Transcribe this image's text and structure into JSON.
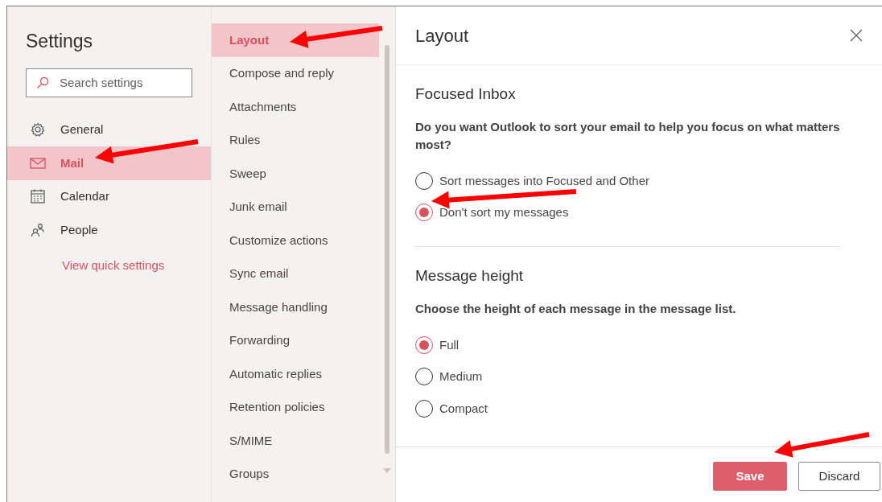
{
  "settings": {
    "title": "Settings",
    "search": {
      "placeholder": "Search settings"
    },
    "categories": [
      {
        "label": "General",
        "kind": "general",
        "selected": false
      },
      {
        "label": "Mail",
        "kind": "mail",
        "selected": true
      },
      {
        "label": "Calendar",
        "kind": "calendar",
        "selected": false
      },
      {
        "label": "People",
        "kind": "people",
        "selected": false
      }
    ],
    "quick_link": "View quick settings"
  },
  "subcategories": [
    {
      "label": "Layout",
      "selected": true
    },
    {
      "label": "Compose and reply",
      "selected": false
    },
    {
      "label": "Attachments",
      "selected": false
    },
    {
      "label": "Rules",
      "selected": false
    },
    {
      "label": "Sweep",
      "selected": false
    },
    {
      "label": "Junk email",
      "selected": false
    },
    {
      "label": "Customize actions",
      "selected": false
    },
    {
      "label": "Sync email",
      "selected": false
    },
    {
      "label": "Message handling",
      "selected": false
    },
    {
      "label": "Forwarding",
      "selected": false
    },
    {
      "label": "Automatic replies",
      "selected": false
    },
    {
      "label": "Retention policies",
      "selected": false
    },
    {
      "label": "S/MIME",
      "selected": false
    },
    {
      "label": "Groups",
      "selected": false
    }
  ],
  "panel": {
    "title": "Layout",
    "sections": [
      {
        "heading": "Focused Inbox",
        "question": "Do you want Outlook to sort your email to help you focus on what matters most?",
        "options": [
          {
            "label": "Sort messages into Focused and Other",
            "selected": false
          },
          {
            "label": "Don't sort my messages",
            "selected": true
          }
        ]
      },
      {
        "heading": "Message height",
        "question": "Choose the height of each message in the message list.",
        "options": [
          {
            "label": "Full",
            "selected": true
          },
          {
            "label": "Medium",
            "selected": false
          },
          {
            "label": "Compact",
            "selected": false
          }
        ]
      }
    ]
  },
  "footer": {
    "buttons": [
      {
        "label": "Save",
        "kind": "primary"
      },
      {
        "label": "Discard",
        "kind": "secondary"
      }
    ]
  }
}
